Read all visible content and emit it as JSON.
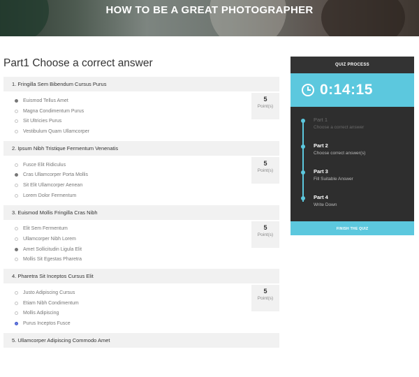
{
  "hero": {
    "title": "HOW TO BE A GREAT PHOTOGRAPHER"
  },
  "part": {
    "title": "Part1 Choose a correct answer"
  },
  "questions": [
    {
      "title": "1. Fringilla Sem Bibendum Cursus Purus",
      "points": "5",
      "points_label": "Point(s)",
      "options": [
        "Euismod Tellus Amet",
        "Magna Condimentum Purus",
        "Sit Ultricies Purus",
        "Vestibulum Quam Ullamcorper"
      ],
      "selected": 0,
      "selected_style": "gray"
    },
    {
      "title": "2. Ipsum Nibh Tristique Fermentum Venenatis",
      "points": "5",
      "points_label": "Point(s)",
      "options": [
        "Fusce Elit Ridiculus",
        "Cras Ullamcorper Porta Mollis",
        "Sit Elit Ullamcorper Aenean",
        "Lorem Dolor Fermentum"
      ],
      "selected": 1,
      "selected_style": "gray"
    },
    {
      "title": "3. Euismod Mollis Fringilla Cras Nibh",
      "points": "5",
      "points_label": "Point(s)",
      "options": [
        "Elit Sem Fermentum",
        "Ullamcorper Nibh Lorem",
        "Amet Sollicitudin Ligula Elit",
        "Mollis Sit Egestas Pharetra"
      ],
      "selected": 2,
      "selected_style": "gray"
    },
    {
      "title": "4. Pharetra Sit Inceptos Cursus Elit",
      "points": "5",
      "points_label": "Point(s)",
      "options": [
        "Justo Adipiscing Cursus",
        "Etiam Nibh Condimentum",
        "Mollis Adipiscing",
        "Purus Inceptos Fusce"
      ],
      "selected": 3,
      "selected_style": "blue"
    },
    {
      "title": "5. Ullamcorper Adipiscing Commodo Amet",
      "points": "",
      "points_label": "",
      "options": [],
      "selected": -1,
      "selected_style": "gray"
    }
  ],
  "sidebar": {
    "header": "QUIZ PROCESS",
    "timer": "0:14:15",
    "steps": [
      {
        "title": "Part 1",
        "subtitle": "Choose a correct answer",
        "state": "done"
      },
      {
        "title": "Part 2",
        "subtitle": "Choose correct answer(s)",
        "state": "active"
      },
      {
        "title": "Part 3",
        "subtitle": "Fill Suitable Answer",
        "state": "active"
      },
      {
        "title": "Part 4",
        "subtitle": "Write Down",
        "state": "active"
      }
    ],
    "finish_label": "FINISH THE QUIZ"
  },
  "colors": {
    "accent": "#5cc8de",
    "dark_panel": "#2e2e2e",
    "header_bar": "#333333"
  }
}
